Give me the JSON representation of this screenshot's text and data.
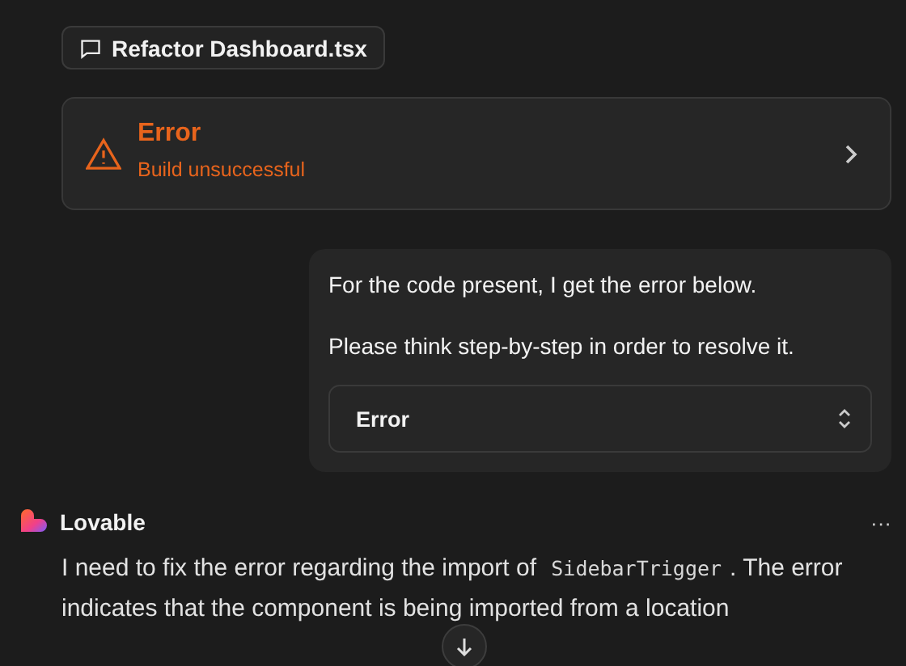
{
  "file_chip": {
    "label": "Refactor Dashboard.tsx"
  },
  "error_card": {
    "title": "Error",
    "subtitle": "Build unsuccessful"
  },
  "user_message": {
    "lines": [
      "For the code present, I get the error below.",
      "Please think step-by-step in order to resolve it."
    ],
    "select": {
      "value": "Error"
    }
  },
  "assistant": {
    "name": "Lovable",
    "menu": "···",
    "parts": [
      {
        "kind": "text",
        "text": "I need to fix the error regarding the import of "
      },
      {
        "kind": "code",
        "text": "SidebarTrigger"
      },
      {
        "kind": "text",
        "text": ". The error indicates that the component is being imported from a location"
      }
    ]
  }
}
